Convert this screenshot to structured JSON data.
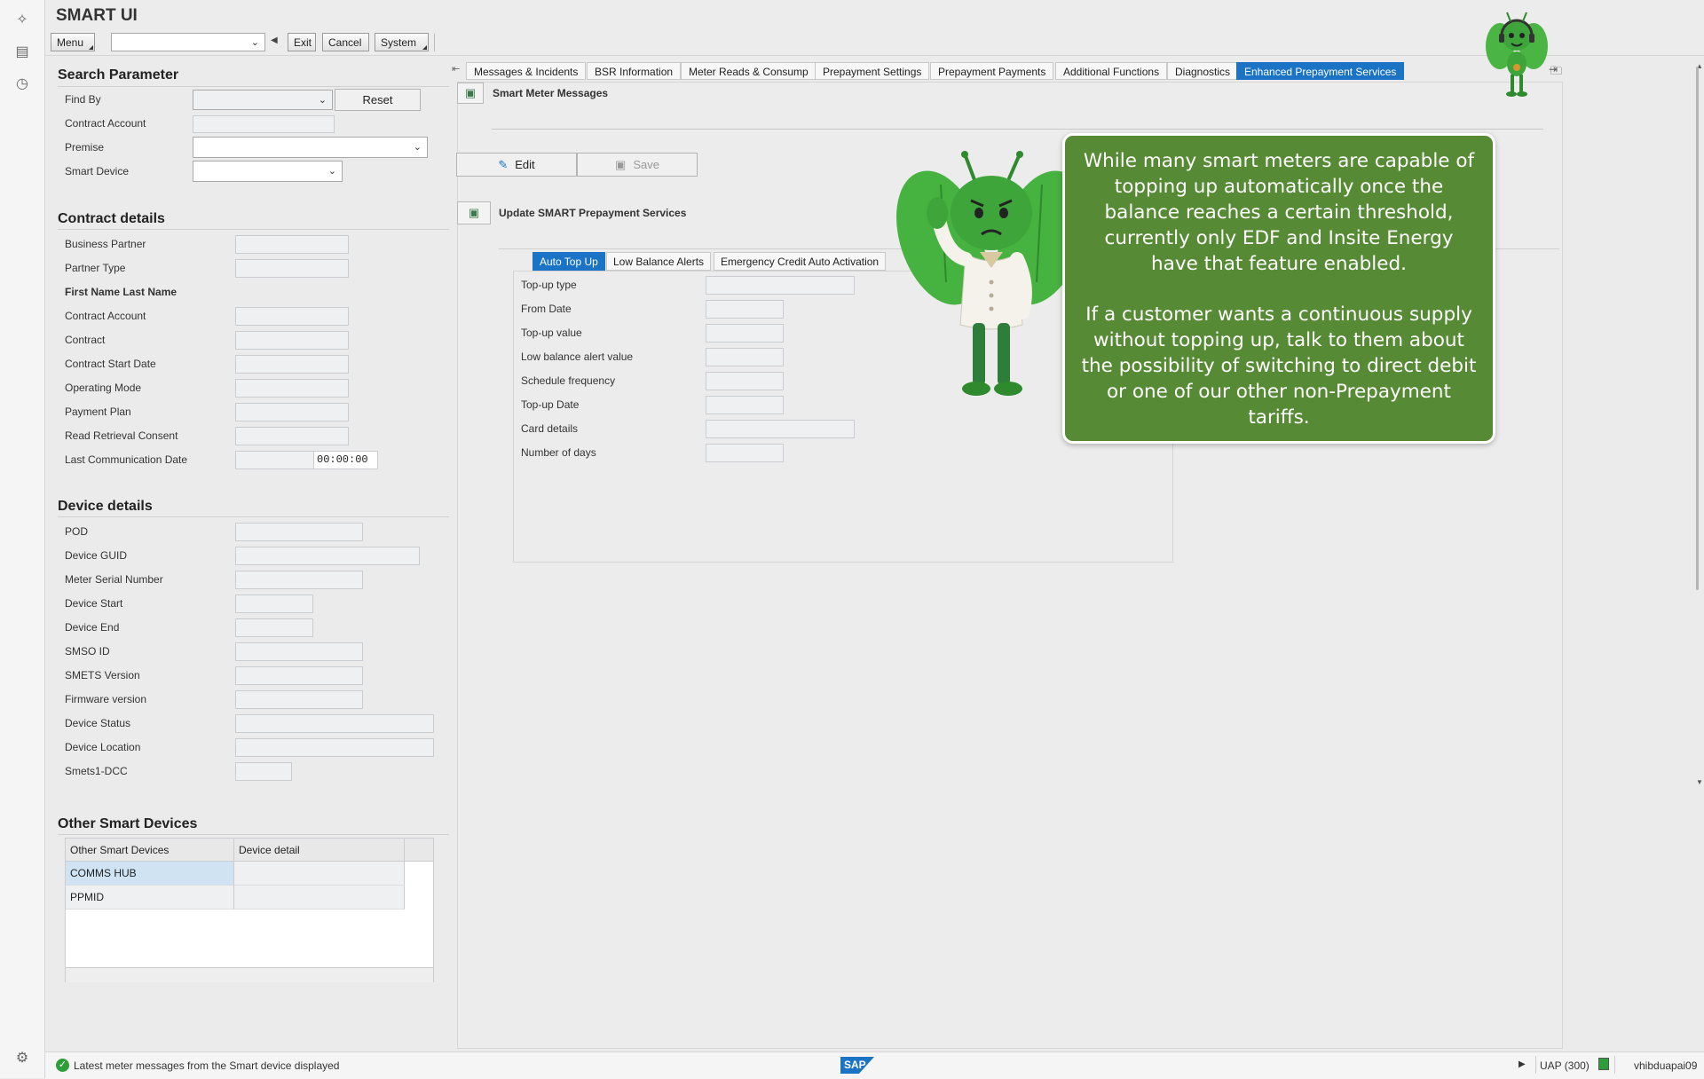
{
  "app": {
    "title": "SMART UI"
  },
  "toolbar": {
    "menu": "Menu",
    "exit": "Exit",
    "cancel": "Cancel",
    "system": "System",
    "command_value": ""
  },
  "search": {
    "title": "Search Parameter",
    "find_by": "Find By",
    "reset": "Reset",
    "contract_account": "Contract Account",
    "premise": "Premise",
    "smart_device": "Smart Device"
  },
  "contract": {
    "title": "Contract details",
    "business_partner": "Business Partner",
    "partner_type": "Partner Type",
    "name": "First Name Last Name",
    "contract_account": "Contract Account",
    "contract": "Contract",
    "contract_start_date": "Contract Start Date",
    "operating_mode": "Operating Mode",
    "payment_plan": "Payment Plan",
    "read_retrieval_consent": "Read Retrieval Consent",
    "last_communication_date": "Last Communication Date",
    "last_communication_time": "00:00:00"
  },
  "device": {
    "title": "Device details",
    "labels": [
      "POD",
      "Device GUID",
      "Meter Serial Number",
      "Device Start",
      "Device End",
      "SMSO ID",
      "SMETS Version",
      "Firmware version",
      "Device Status",
      "Device Location",
      "Smets1-DCC"
    ]
  },
  "other_devices": {
    "title": "Other Smart Devices",
    "headers": [
      "Other Smart Devices",
      "Device detail"
    ],
    "rows": [
      [
        "COMMS HUB",
        ""
      ],
      [
        "PPMID",
        ""
      ]
    ]
  },
  "tabs": [
    "Messages & Incidents",
    "BSR Information",
    "Meter Reads & Consump",
    "Prepayment Settings",
    "Prepayment Payments",
    "Additional Functions",
    "Diagnostics",
    "Enhanced Prepayment Services"
  ],
  "main": {
    "smart_meter_messages": "Smart Meter Messages",
    "edit": "Edit",
    "save": "Save",
    "update_services": "Update SMART Prepayment Services",
    "subtabs": [
      "Auto Top Up",
      "Low Balance Alerts",
      "Emergency Credit Auto Activation"
    ],
    "form_labels": [
      "Top-up type",
      "From Date",
      "Top-up value",
      "Low balance alert value",
      "Schedule frequency",
      "Top-up Date",
      "Card details",
      "Number of days"
    ]
  },
  "callout": {
    "p1": "While many smart meters are capable of topping up automatically once the balance reaches a certain threshold, currently only EDF and Insite Energy have that feature enabled.",
    "p2": "If a customer wants a continuous supply without topping up, talk to them about the possibility of switching to direct debit or one of our other non-Prepayment tariffs."
  },
  "status": {
    "message": "Latest meter messages from the Smart device displayed",
    "logo": "SAP",
    "system": "UAP (300)",
    "user": "vhibduapai09"
  },
  "colors": {
    "active_tab": "#1a73c4",
    "callout_bg": "#568a34",
    "mascot": "#3da53a"
  }
}
